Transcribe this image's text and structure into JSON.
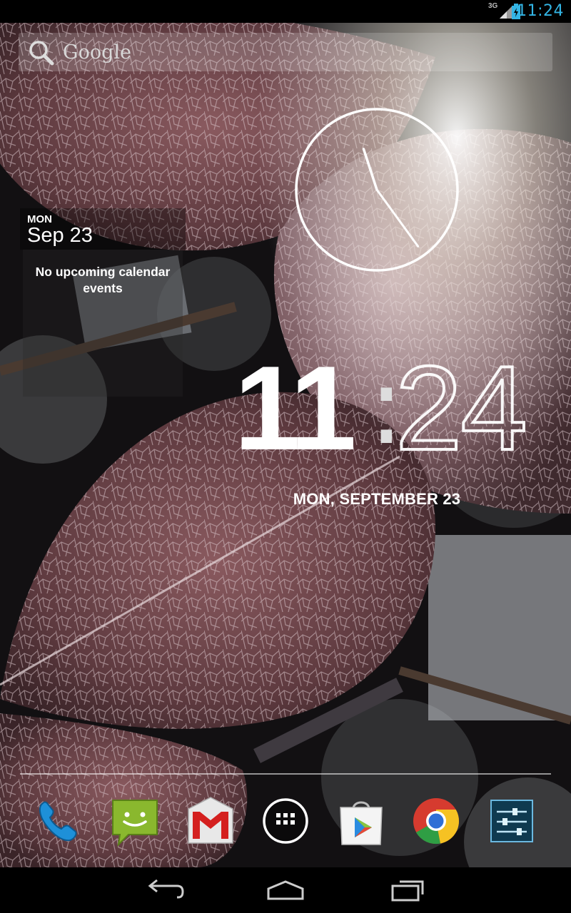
{
  "status_bar": {
    "network": "3G",
    "time": "11:24",
    "accent": "#33b5e5"
  },
  "search": {
    "label": "Google",
    "icon": "search-icon"
  },
  "calendar_widget": {
    "day": "MON",
    "date": "Sep 23",
    "empty_text": "No upcoming calendar events"
  },
  "analog_clock": {
    "hour": 11,
    "minute": 24
  },
  "digital_clock": {
    "hours": "11",
    "separator": ":",
    "minutes": "24",
    "date": "MON, SEPTEMBER 23"
  },
  "dock": {
    "items": [
      {
        "name": "phone",
        "icon": "phone-icon"
      },
      {
        "name": "messaging",
        "icon": "messaging-icon"
      },
      {
        "name": "gmail",
        "icon": "gmail-icon"
      },
      {
        "name": "all-apps",
        "icon": "apps-grid-icon"
      },
      {
        "name": "play-store",
        "icon": "play-store-icon"
      },
      {
        "name": "chrome",
        "icon": "chrome-icon"
      },
      {
        "name": "settings",
        "icon": "settings-icon"
      }
    ]
  },
  "nav_bar": {
    "buttons": [
      "back-icon",
      "home-icon",
      "recents-icon"
    ]
  }
}
